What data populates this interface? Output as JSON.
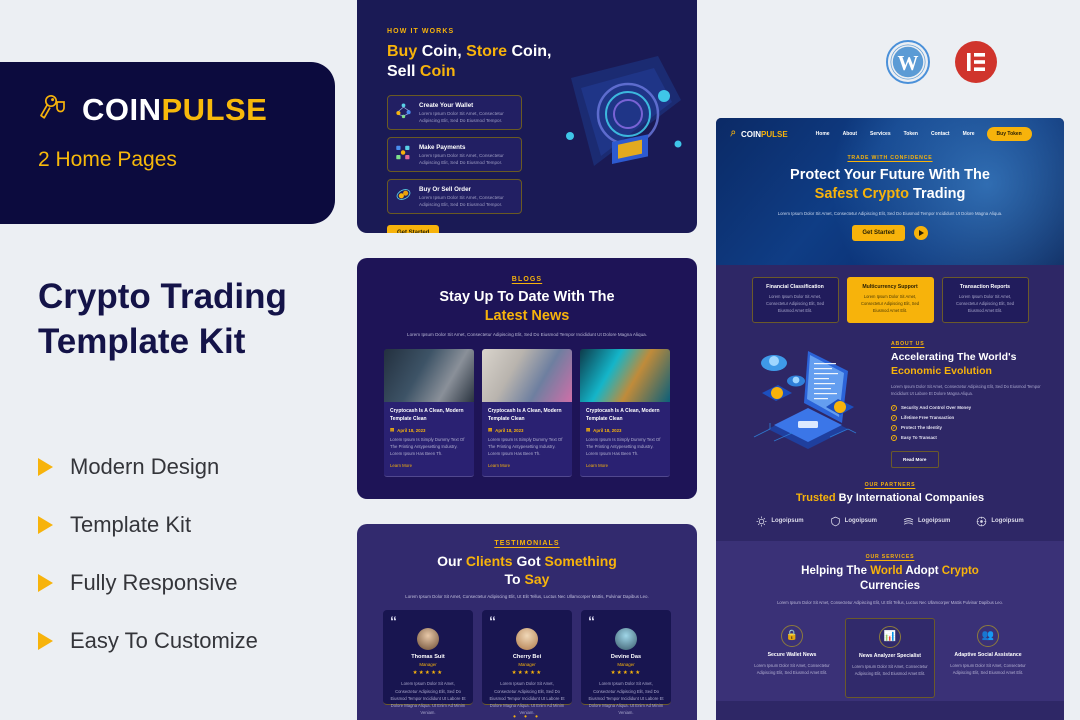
{
  "brand": {
    "name_white": "COIN",
    "name_yellow": "PULSE",
    "subtitle": "2 Home Pages",
    "accent": "#f7b30b",
    "dark": "#0c0b3e",
    "navy": "#141348"
  },
  "promo": {
    "title": "Crypto Trading Template Kit",
    "features": [
      "Modern Design",
      "Template Kit",
      "Fully Responsive",
      "Easy To Customize"
    ]
  },
  "plugins": [
    {
      "name": "WordPress",
      "icon": "wordpress-icon",
      "color": "#4a90d9"
    },
    {
      "name": "Elementor",
      "icon": "elementor-icon",
      "color": "#d0342c"
    }
  ],
  "how_it_works": {
    "eyebrow": "HOW IT WORKS",
    "title_parts": [
      {
        "text": "Buy ",
        "color": "yellow"
      },
      {
        "text": "Coin, ",
        "color": "white"
      },
      {
        "text": "Store ",
        "color": "yellow"
      },
      {
        "text": "Coin, ",
        "color": "white"
      },
      {
        "text": "Sell ",
        "color": "white"
      },
      {
        "text": "Coin",
        "color": "yellow"
      }
    ],
    "title_line1_a": "Buy",
    "title_line1_b": "Coin,",
    "title_line1_c": "Store",
    "title_line1_d": "Coin,",
    "title_line2_a": "Sell",
    "title_line2_b": "Coin",
    "steps": [
      {
        "icon": "wallet-network-icon",
        "title": "Create Your Wallet",
        "desc": "Lorem Ipsum Dolor Sit Amet, Consectetur Adipiscing Elit, Sed Do Eiusmod Tempor."
      },
      {
        "icon": "payments-icon",
        "title": "Make Payments",
        "desc": "Lorem Ipsum Dolor Sit Amet, Consectetur Adipiscing Elit, Sed Do Eiusmod Tempor."
      },
      {
        "icon": "coins-icon",
        "title": "Buy Or Sell Order",
        "desc": "Lorem Ipsum Dolor Sit Amet, Consectetur Adipiscing Elit, Sed Do Eiusmod Tempor."
      }
    ],
    "cta": "Get Started"
  },
  "blogs": {
    "eyebrow": "BLOGS",
    "title_white": "Stay Up To Date With The",
    "title_yellow": "Latest News",
    "subtitle": "Lorem Ipsum Dolor Sit Amet, Consectetur Adipiscing Elit, Sed Do Eiusmod Tempor Incididunt Ut Dolore Magna Aliqua.",
    "cards": [
      {
        "image": "bitcoin-shopping-basket-photo",
        "title": "Cryptocash Is A Clean, Modern Template Clean",
        "date": "April 18, 2023",
        "text": "Lorem Ipsum Is Simply Dummy Text Of The Printing Antypesetting Industry. Lorem Ipsum Has Been Th.",
        "link": "Learn More"
      },
      {
        "image": "bitcoin-glass-ball-photo",
        "title": "Cryptocash Is A Clean, Modern Template Clean",
        "date": "April 18, 2023",
        "text": "Lorem Ipsum Is Simply Dummy Text Of The Printing Antypesetting Industry. Lorem Ipsum Has Been Th.",
        "link": "Learn More"
      },
      {
        "image": "bitcoin-stack-circuit-photo",
        "title": "Cryptocash Is A Clean, Modern Template Clean",
        "date": "April 18, 2023",
        "text": "Lorem Ipsum Is Simply Dummy Text Of The Printing Antypesetting Industry. Lorem Ipsum Has Been Th.",
        "link": "Learn More"
      }
    ]
  },
  "testimonials": {
    "eyebrow": "TESTIMONIALS",
    "title_l1_a": "Our",
    "title_l1_b": "Clients",
    "title_l1_c": "Got",
    "title_l1_d": "Something",
    "title_l2_a": "To",
    "title_l2_b": "Say",
    "subtitle": "Lorem Ipsum Dolor Sit Amet, Consectetur Adipiscing Elit, Ut Elit Tellus, Luctus Nec Ullamcorper Mattis, Pulvinar Dapibus Leo.",
    "quote_mark": "“",
    "cards": [
      {
        "avatar": "avatar-thomas",
        "name": "Thomas Suit",
        "role": "Manager",
        "stars": "★★★★★",
        "text": "Lorem Ipsum Dolor Sit Amet, Consectetur Adipiscing Elit, Sed Do Eiusmod Tempor Incididunt Ut Labore Et Dolore Magna Aliqua. Ut Enim Ad Minim Veniam."
      },
      {
        "avatar": "avatar-cherry",
        "name": "Cherry Bei",
        "role": "Manager",
        "stars": "★★★★★",
        "text": "Lorem Ipsum Dolor Sit Amet, Consectetur Adipiscing Elit, Sed Do Eiusmod Tempor Incididunt Ut Labore Et Dolore Magna Aliqua. Ut Enim Ad Minim Veniam."
      },
      {
        "avatar": "avatar-devine",
        "name": "Devine Das",
        "role": "Manager",
        "stars": "★★★★★",
        "text": "Lorem Ipsum Dolor Sit Amet, Consectetur Adipiscing Elit, Sed Do Eiusmod Tempor Incididunt Ut Labore Et Dolore Magna Aliqua. Ut Enim Ad Minim Veniam."
      }
    ],
    "pager": "• • •"
  },
  "site": {
    "nav": {
      "logo_white": "COIN",
      "logo_yellow": "PULSE",
      "links": [
        "Home",
        "About",
        "Services",
        "Token",
        "Contact",
        "More"
      ],
      "cta": "Buy Token"
    },
    "hero": {
      "eyebrow": "TRADE WITH CONFIDENCE",
      "title_l1": "Protect Your Future With The",
      "title_l2_yellow": "Safest Crypto",
      "title_l2_white": "Trading",
      "paragraph": "Lorem Ipsum Dolor Sit Amet, Consectetur Adipiscing Elit, Sed Do Eiusmod Tempor Incididunt Ut Dolore Magna Aliqua.",
      "cta": "Get Started",
      "play_icon": "play-icon"
    },
    "features": [
      {
        "title": "Financial Classification",
        "desc": "Lorem Ipsum Dolor Sit Amet, Consectetur Adipiscing Elit, Sed Eiusmod Amet Elit.",
        "highlight": false
      },
      {
        "title": "Multicurrency Support",
        "desc": "Lorem Ipsum Dolor Sit Amet, Consectetur Adipiscing Elit, Sed Eiusmod Amet Elit.",
        "highlight": true
      },
      {
        "title": "Transaction Reports",
        "desc": "Lorem Ipsum Dolor Sit Amet, Consectetur Adipiscing Elit, Sed Eiusmod Amet Elit.",
        "highlight": false
      }
    ],
    "about": {
      "eyebrow": "ABOUT US",
      "title_l1": "Accelerating The World's",
      "title_l2_yellow": "Economic Evolution",
      "paragraph": "Lorem Ipsum Dolor Sit Amet, Consectetur Adipiscing Elit, Sed Do Eiusmod Tempor Incididunt Ut Labore Et Dolore Magna Aliqua.",
      "checklist": [
        "Security And Control Over Money",
        "Lifetime Free Transaction",
        "Protect The Identity",
        "Easy To Transact"
      ],
      "check_glyph": "✓",
      "cta": "Read More",
      "illustration": "isometric-laptop-crypto-illustration"
    },
    "partners": {
      "eyebrow": "OUR PARTNERS",
      "title_yellow": "Trusted",
      "title_white": "By International Companies",
      "logos": [
        {
          "icon": "sun-burst-logo-icon",
          "label": "Logoipsum"
        },
        {
          "icon": "shield-logo-icon",
          "label": "Logoipsum"
        },
        {
          "icon": "wave-logo-icon",
          "label": "Logoipsum"
        },
        {
          "icon": "gear-circle-logo-icon",
          "label": "Logoipsum"
        }
      ]
    },
    "services": {
      "eyebrow": "OUR SERVICES",
      "title_l1_a": "Helping The",
      "title_l1_b": "World",
      "title_l1_c": "Adopt",
      "title_l1_d": "Crypto",
      "title_l2": "Currencies",
      "paragraph": "Lorem Ipsum Dolor Sit Amet, Consectetur Adipiscing Elit, Ut Elit Tellus, Luctus Nec Ullamcorper Mattis Pulvinar Dapibus Leo.",
      "cards": [
        {
          "icon": "🔒",
          "icon_name": "lock-wallet-icon",
          "title": "Secure Wallet News",
          "desc": "Lorem Ipsum Dolor Sit Amet, Consectetur Adipiscing Elit, Sed Eiusmod Amet Elit.",
          "highlight": false
        },
        {
          "icon": "📊",
          "icon_name": "news-analyzer-icon",
          "title": "News Analyzer Specialist",
          "desc": "Lorem Ipsum Dolor Sit Amet, Consectetur Adipiscing Elit, Sed Eiusmod Amet Elit.",
          "highlight": true
        },
        {
          "icon": "👥",
          "icon_name": "social-assistance-icon",
          "title": "Adaptive Social Assistance",
          "desc": "Lorem Ipsum Dolor Sit Amet, Consectetur Adipiscing Elit, Sed Eiusmod Amet Elit.",
          "highlight": false
        }
      ]
    }
  }
}
